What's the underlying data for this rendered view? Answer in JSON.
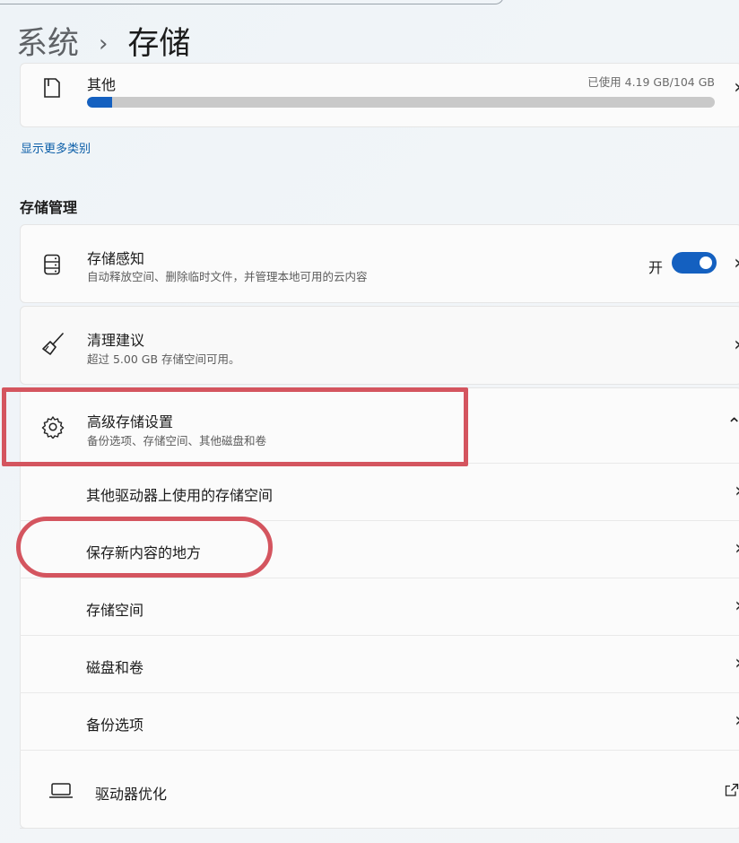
{
  "breadcrumb": {
    "parent": "系统",
    "separator": "›",
    "current": "存储"
  },
  "other_category": {
    "label": "其他",
    "usage": "已使用 4.19 GB/104 GB",
    "fill_fraction": 0.04
  },
  "show_more_link": "显示更多类别",
  "section_title": "存储管理",
  "storage_sense": {
    "title": "存储感知",
    "subtitle": "自动释放空间、删除临时文件，并管理本地可用的云内容",
    "toggle_label": "开",
    "toggle_on": true
  },
  "cleanup": {
    "title": "清理建议",
    "subtitle": "超过 5.00 GB 存储空间可用。"
  },
  "advanced": {
    "title": "高级存储设置",
    "subtitle": "备份选项、存储空间、其他磁盘和卷",
    "items": [
      {
        "label": "其他驱动器上使用的存储空间"
      },
      {
        "label": "保存新内容的地方"
      },
      {
        "label": "存储空间"
      },
      {
        "label": "磁盘和卷"
      },
      {
        "label": "备份选项"
      }
    ]
  },
  "drive_opt": {
    "label": "驱动器优化"
  },
  "colors": {
    "accent": "#1460c0",
    "highlight": "#d4555f",
    "link": "#0b5ea8"
  },
  "icons": [
    "phone-storage-icon",
    "storage-sense-icon",
    "broom-icon",
    "gear-icon",
    "laptop-icon",
    "external-link-icon",
    "chevron-right-icon",
    "chevron-up-icon"
  ]
}
